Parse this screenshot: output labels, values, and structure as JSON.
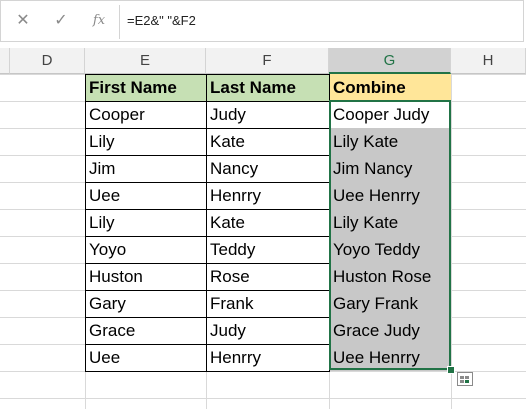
{
  "formula_bar": {
    "cancel_icon": "✕",
    "enter_icon": "✓",
    "fx_label": "fx",
    "formula": "=E2&\" \"&F2"
  },
  "columns": {
    "D": "D",
    "E": "E",
    "F": "F",
    "G": "G",
    "H": "H"
  },
  "table": {
    "headers": [
      "First Name",
      "Last Name",
      "Combine"
    ],
    "rows": [
      [
        "Cooper",
        "Judy",
        "Cooper Judy"
      ],
      [
        "Lily",
        "Kate",
        "Lily Kate"
      ],
      [
        "Jim",
        "Nancy",
        "Jim Nancy"
      ],
      [
        "Uee",
        "Henrry",
        "Uee Henrry"
      ],
      [
        "Lily",
        "Kate",
        "Lily Kate"
      ],
      [
        "Yoyo",
        "Teddy",
        "Yoyo Teddy"
      ],
      [
        "Huston",
        "Rose",
        "Huston Rose"
      ],
      [
        "Gary",
        "Frank",
        "Gary Frank"
      ],
      [
        "Grace",
        "Judy",
        "Grace Judy"
      ],
      [
        "Uee",
        "Henrry",
        "Uee Henrry"
      ]
    ]
  },
  "colors": {
    "header_green": "#c6e0b4",
    "header_yellow": "#ffe699",
    "selection_grey": "#c8c8c8",
    "selection_border": "#217346"
  }
}
